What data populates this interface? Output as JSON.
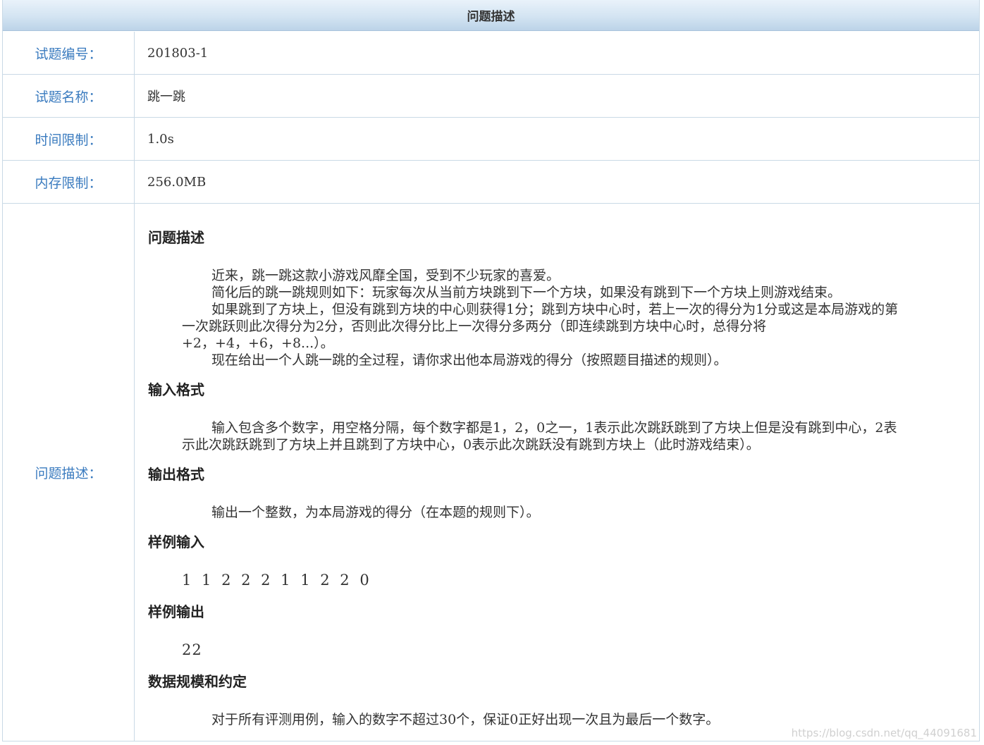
{
  "header": {
    "title": "问题描述"
  },
  "rows": [
    {
      "label": "试题编号：",
      "value": "201803-1"
    },
    {
      "label": "试题名称：",
      "value": "跳一跳"
    },
    {
      "label": "时间限制：",
      "value": "1.0s"
    },
    {
      "label": "内存限制：",
      "value": "256.0MB"
    }
  ],
  "description": {
    "label": "问题描述：",
    "sections": {
      "problem": {
        "heading": "问题描述",
        "p1": "近来，跳一跳这款小游戏风靡全国，受到不少玩家的喜爱。",
        "p2": "简化后的跳一跳规则如下：玩家每次从当前方块跳到下一个方块，如果没有跳到下一个方块上则游戏结束。",
        "p3a": "如果跳到了方块上，但没有跳到方块的中心则获得1分；跳到方块中心时，若上一次的得分为1分或这是本局游戏的第",
        "p3b": "一次跳跃则此次得分为2分，否则此次得分比上一次得分多两分（即连续跳到方块中心时，总得分将",
        "p3c": "+2，+4，+6，+8...）。",
        "p4": "现在给出一个人跳一跳的全过程，请你求出他本局游戏的得分（按照题目描述的规则）。"
      },
      "input": {
        "heading": "输入格式",
        "p1a": "输入包含多个数字，用空格分隔，每个数字都是1，2，0之一，1表示此次跳跃跳到了方块上但是没有跳到中心，2表",
        "p1b": "示此次跳跃跳到了方块上并且跳到了方块中心，0表示此次跳跃没有跳到方块上（此时游戏结束）。"
      },
      "output": {
        "heading": "输出格式",
        "p1": "输出一个整数，为本局游戏的得分（在本题的规则下）。"
      },
      "sample_input": {
        "heading": "样例输入",
        "value": "1 1 2 2 2 1 1 2 2 0"
      },
      "sample_output": {
        "heading": "样例输出",
        "value": "22"
      },
      "constraints": {
        "heading": "数据规模和约定",
        "p1": "对于所有评测用例，输入的数字不超过30个，保证0正好出现一次且为最后一个数字。"
      }
    }
  },
  "watermark": "https://blog.csdn.net/qq_44091681"
}
